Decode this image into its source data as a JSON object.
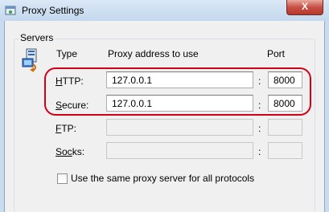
{
  "window": {
    "title": "Proxy Settings",
    "close_glyph": "X"
  },
  "servers": {
    "group_label": "Servers",
    "headers": {
      "type": "Type",
      "address": "Proxy address to use",
      "port": "Port"
    },
    "rows": [
      {
        "key": "HTTP",
        "label_accel": "H",
        "label_rest": "TTP:",
        "address": "127.0.0.1",
        "port": "8000"
      },
      {
        "key": "Secure",
        "label_accel": "S",
        "label_rest": "ecure:",
        "address": "127.0.0.1",
        "port": "8000"
      },
      {
        "key": "FTP",
        "label_accel": "F",
        "label_rest": "TP:",
        "address": "",
        "port": ""
      },
      {
        "key": "Socks",
        "label_accel": "Soc",
        "label_rest": "ks:",
        "address": "",
        "port": ""
      }
    ],
    "colon": ":",
    "same_proxy_checkbox": {
      "label": "Use the same proxy server for all protocols",
      "checked": false
    }
  },
  "colors": {
    "highlight": "#d40018"
  }
}
